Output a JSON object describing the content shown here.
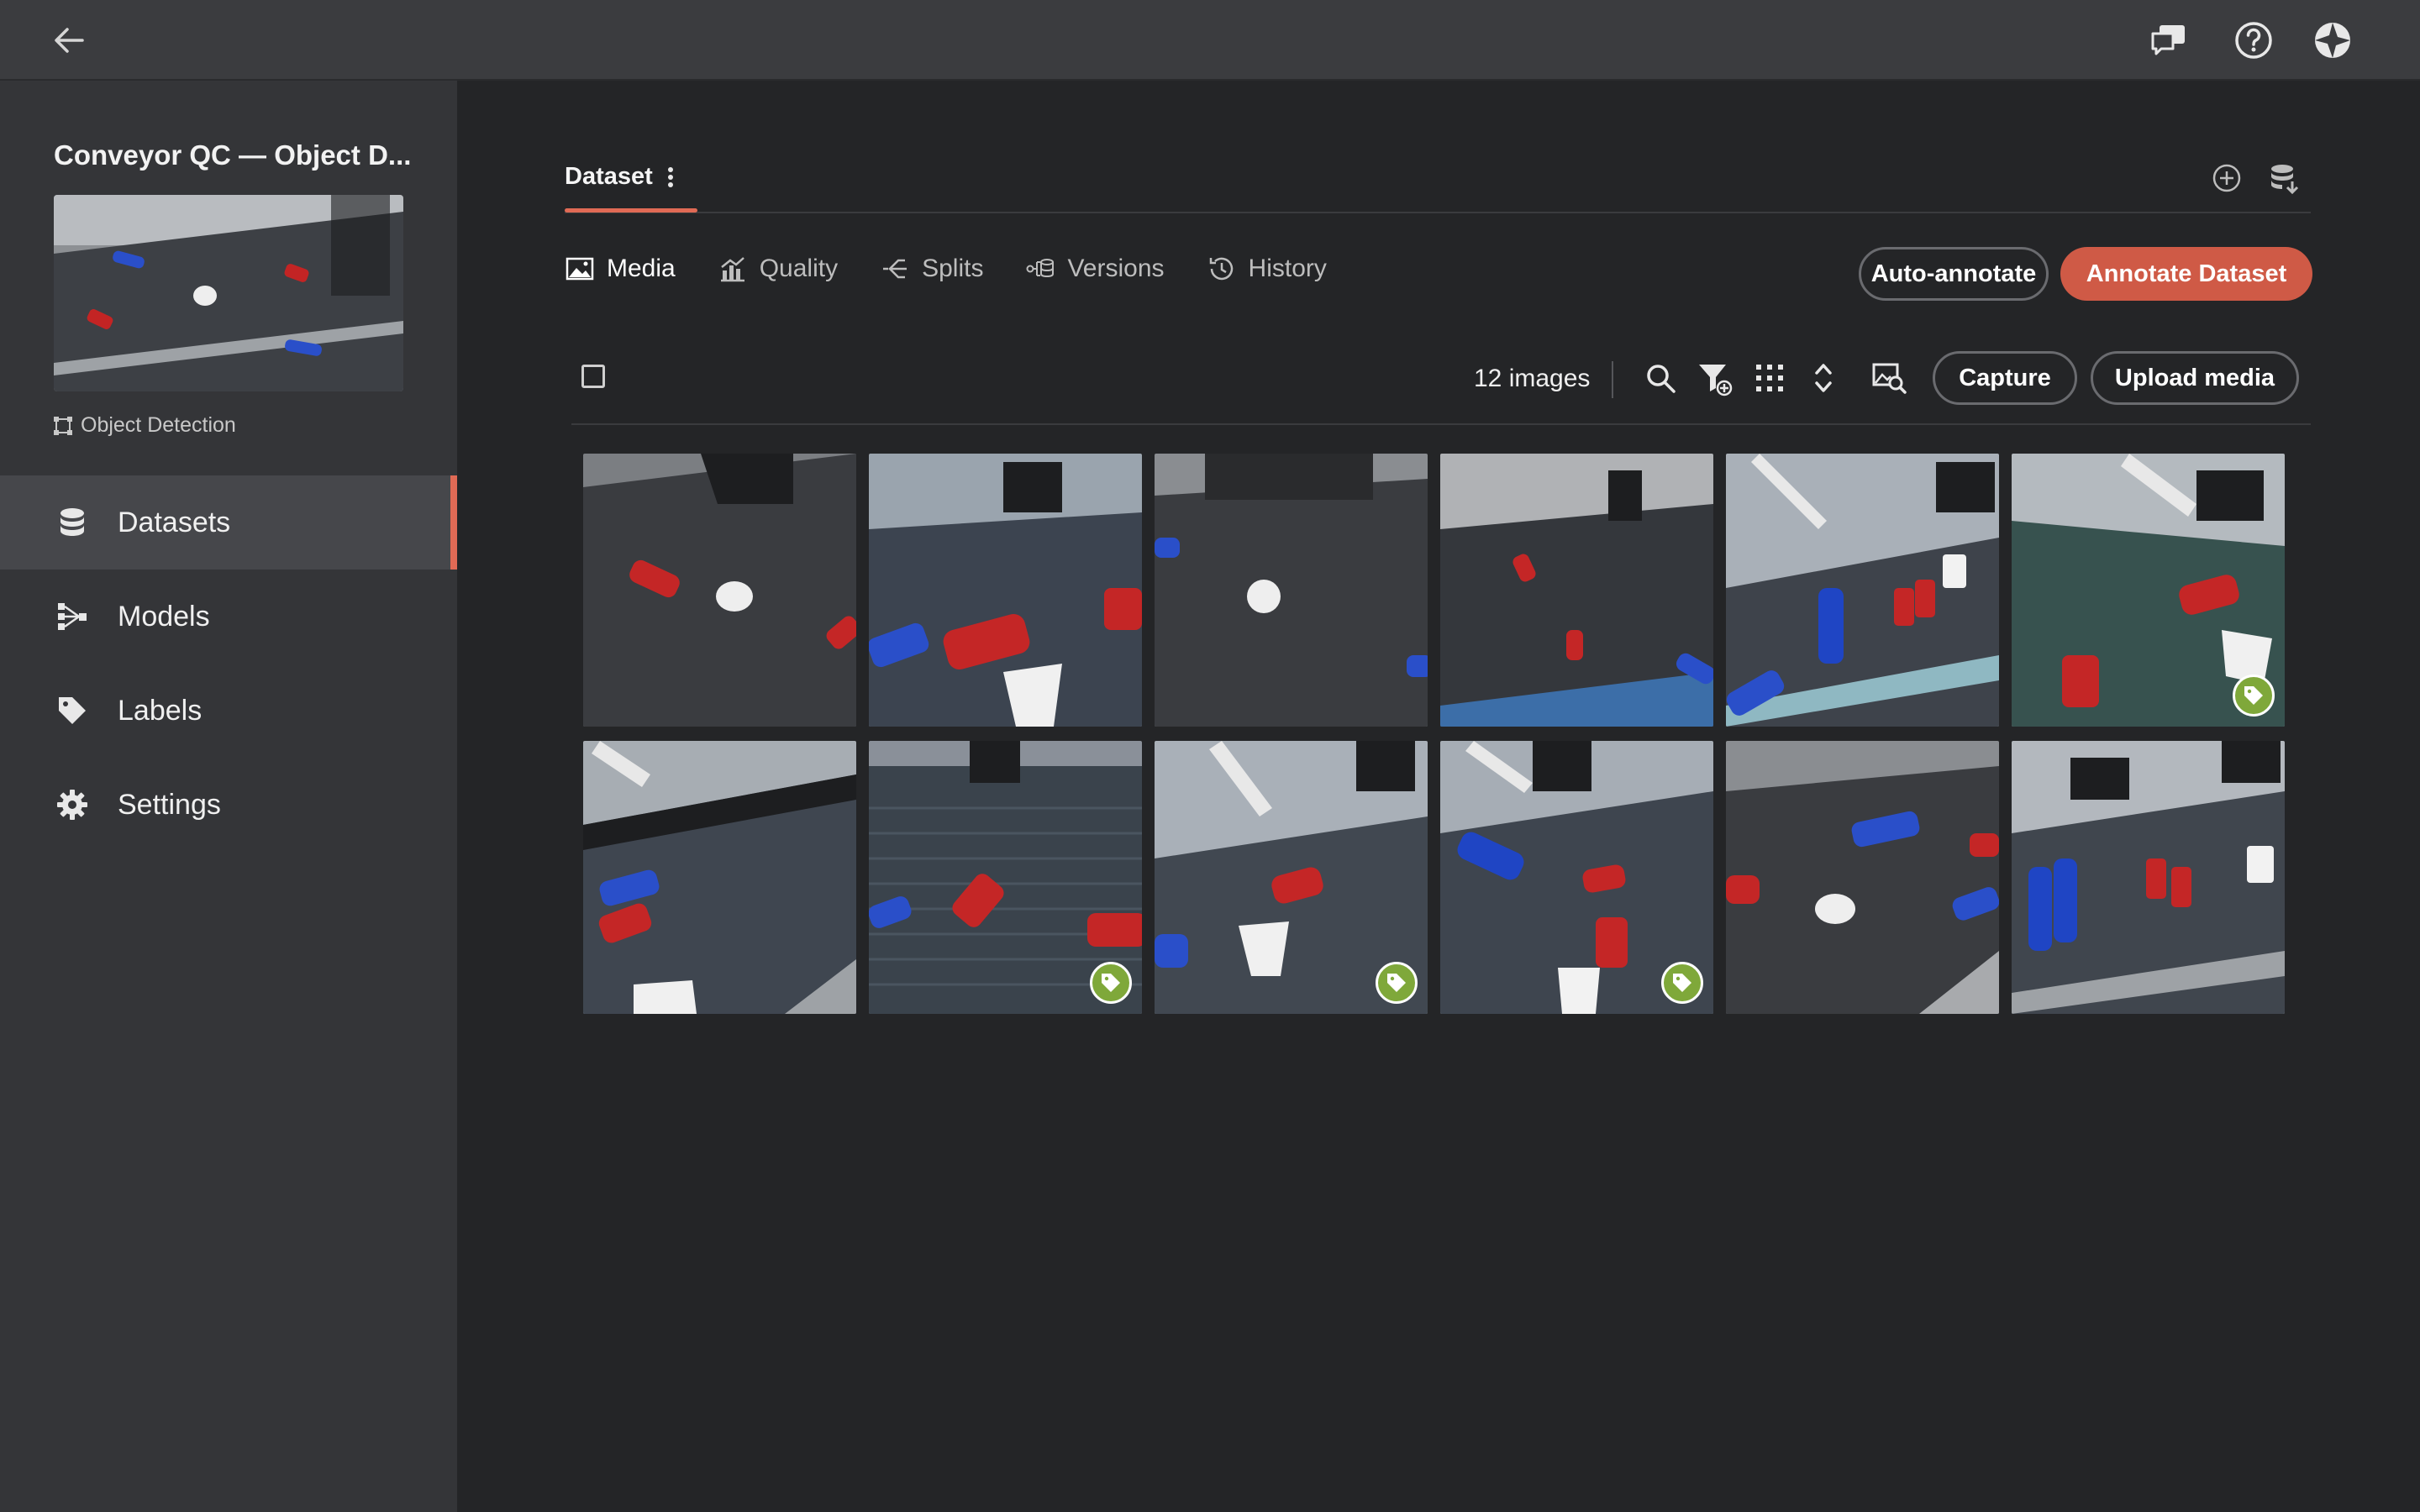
{
  "project": {
    "title": "Conveyor QC — Object D...",
    "type": "Object Detection"
  },
  "nav": {
    "items": [
      {
        "label": "Datasets",
        "icon": "database-icon",
        "active": true
      },
      {
        "label": "Models",
        "icon": "model-icon",
        "active": false
      },
      {
        "label": "Labels",
        "icon": "tag-icon",
        "active": false
      },
      {
        "label": "Settings",
        "icon": "gear-icon",
        "active": false
      }
    ]
  },
  "dataset": {
    "tab_label": "Dataset",
    "subtabs": [
      {
        "label": "Media",
        "icon": "image-icon",
        "active": true
      },
      {
        "label": "Quality",
        "icon": "chart-icon",
        "active": false
      },
      {
        "label": "Splits",
        "icon": "split-icon",
        "active": false
      },
      {
        "label": "Versions",
        "icon": "versions-icon",
        "active": false
      },
      {
        "label": "History",
        "icon": "history-icon",
        "active": false
      }
    ],
    "auto_annotate_label": "Auto-annotate",
    "annotate_label": "Annotate Dataset"
  },
  "toolbar": {
    "count": "12 images",
    "capture_label": "Capture",
    "upload_label": "Upload media"
  },
  "colors": {
    "accent": "#cf5a46",
    "badge": "#7fa83a"
  },
  "media": [
    {
      "tagged": false
    },
    {
      "tagged": false
    },
    {
      "tagged": false
    },
    {
      "tagged": false
    },
    {
      "tagged": false
    },
    {
      "tagged": true
    },
    {
      "tagged": false
    },
    {
      "tagged": true
    },
    {
      "tagged": true
    },
    {
      "tagged": true
    },
    {
      "tagged": false
    },
    {
      "tagged": false
    }
  ]
}
